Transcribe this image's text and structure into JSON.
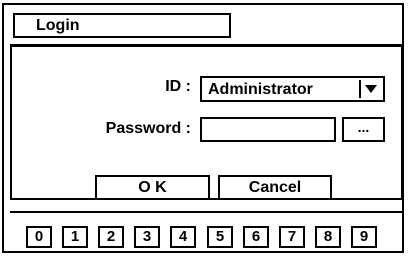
{
  "dialog": {
    "title": "Login"
  },
  "form": {
    "id_label": "ID :",
    "id_value": "Administrator",
    "password_label": "Password :",
    "password_value": "",
    "browse_label": "..."
  },
  "buttons": {
    "ok_label": "O K",
    "cancel_label": "Cancel"
  },
  "keypad": {
    "keys": [
      "0",
      "1",
      "2",
      "3",
      "4",
      "5",
      "6",
      "7",
      "8",
      "9"
    ]
  }
}
